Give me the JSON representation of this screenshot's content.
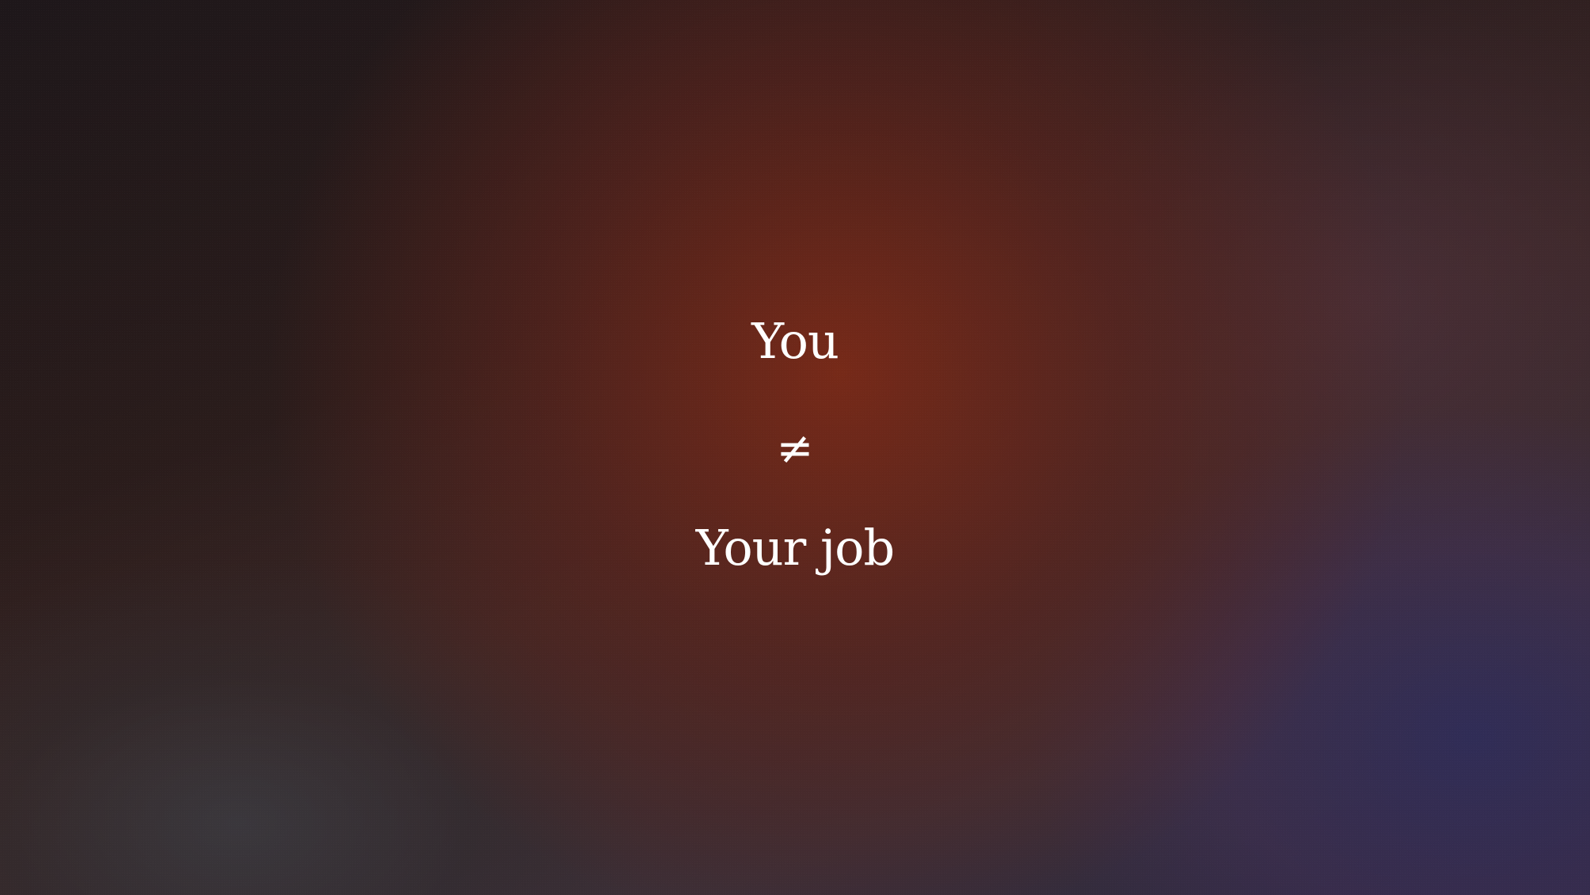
{
  "slide": {
    "line1": "You",
    "line2": "≠",
    "line3": "Your job"
  },
  "colors": {
    "text": "#ffffff",
    "warm_glow": "#7a2a18",
    "cool_corner": "#2a2742",
    "base_dark": "#1e171a"
  }
}
